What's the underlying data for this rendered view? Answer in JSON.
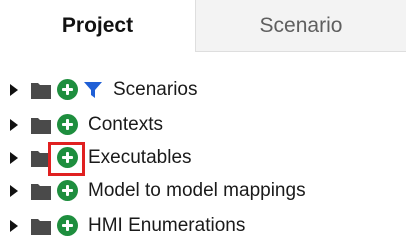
{
  "tabs": {
    "project_label": "Project",
    "scenario_label": "Scenario"
  },
  "tree": {
    "items": [
      {
        "label": "Scenarios",
        "icon": "filter-icon"
      },
      {
        "label": "Contexts"
      },
      {
        "label": "Executables"
      },
      {
        "label": "Model to model mappings"
      },
      {
        "label": "HMI Enumerations"
      }
    ]
  },
  "colors": {
    "accent_green": "#1e8e3e",
    "filter_blue": "#1f5fd6",
    "folder_gray": "#4a4a4a",
    "highlight_red": "#e02020"
  }
}
